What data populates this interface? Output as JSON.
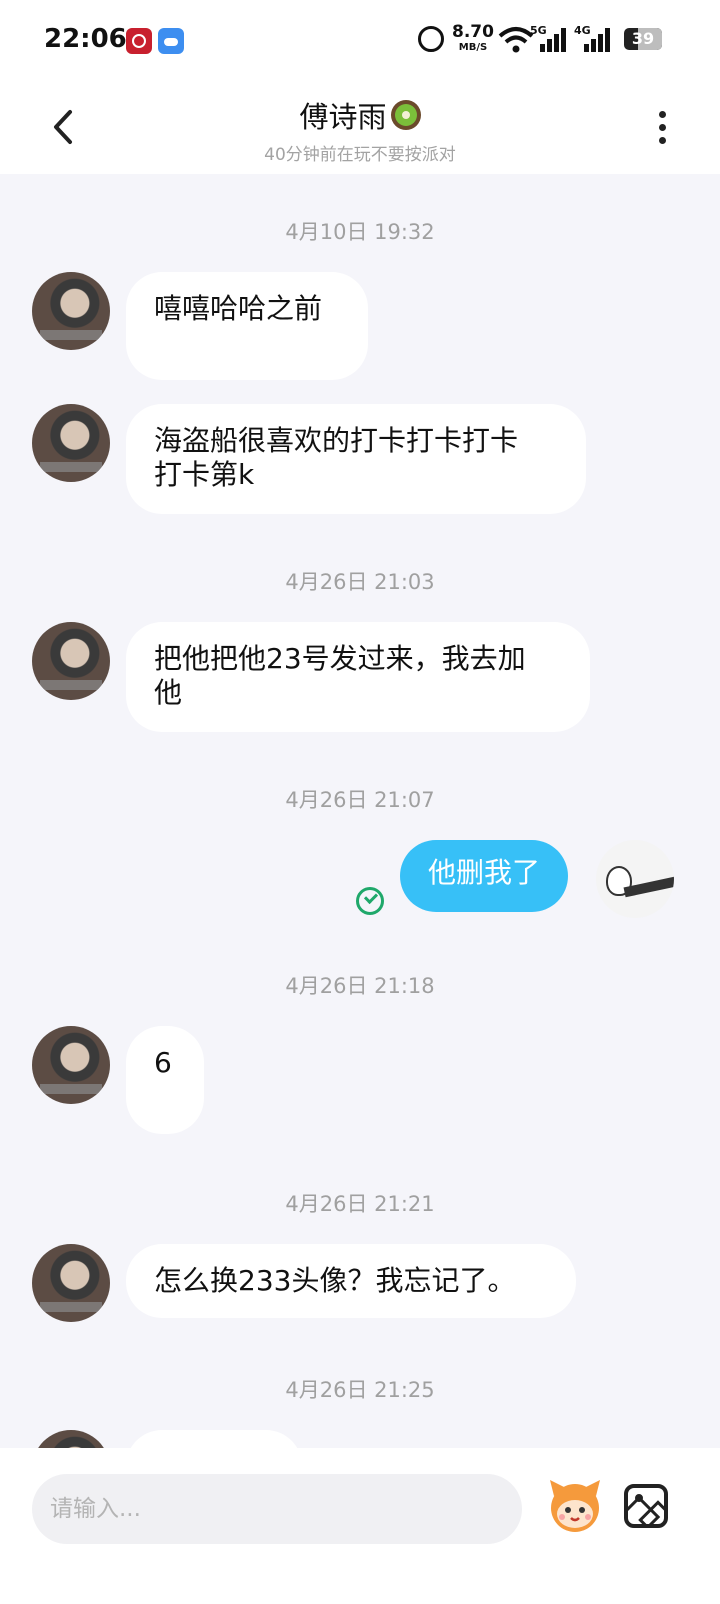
{
  "status_bar": {
    "time": "22:06",
    "net_speed": "8.70",
    "net_speed_unit": "MB/S",
    "signal1_label": "5G",
    "signal2_label": "4G",
    "battery": "39"
  },
  "header": {
    "title": "傅诗雨",
    "subtitle": "40分钟前在玩不要按派对"
  },
  "messages": {
    "ts1": "4月10日 19:32",
    "m1": "嘻嘻哈哈之前",
    "m2_line1": "海盗船很喜欢的打卡打卡打卡",
    "m2_line2": "打卡第k",
    "ts2": "4月26日 21:03",
    "m3_line1": "把他把他23号发过来，我去加",
    "m3_line2": "他",
    "ts3": "4月26日 21:07",
    "m4": "他删我了",
    "ts4": "4月26日 21:18",
    "m5": "6",
    "ts5": "4月26日 21:21",
    "m6": "怎么换233头像？我忘记了。",
    "ts6": "4月26日 21:25"
  },
  "input": {
    "placeholder": "请输入..."
  },
  "colors": {
    "background": "#f5f5fa",
    "bubble_other": "#ffffff",
    "bubble_me": "#37c0f7",
    "timestamp": "#a0a0a0",
    "sent_check": "#1fa86a"
  },
  "icons": {
    "back": "chevron-left-icon",
    "more": "more-vertical-icon",
    "sent_status": "check-circle-icon",
    "emoji": "emoji-sticker-icon",
    "image": "image-icon"
  }
}
